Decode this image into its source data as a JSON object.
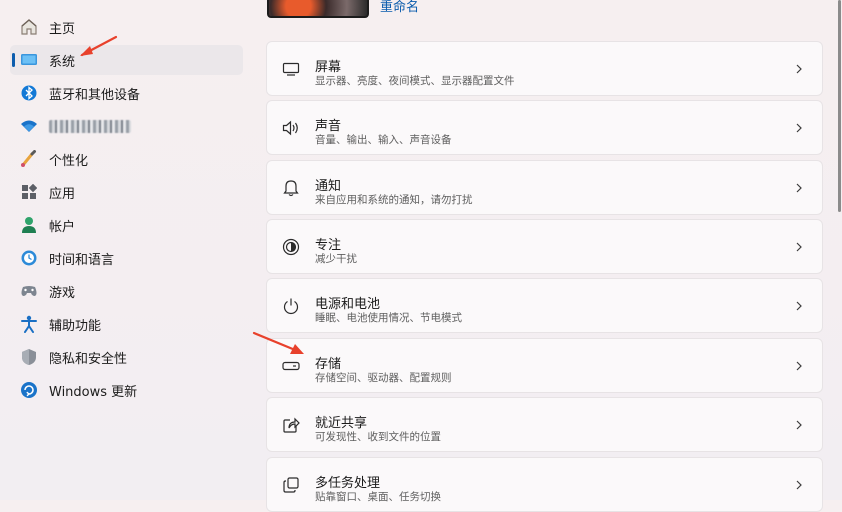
{
  "sidebar": {
    "items": [
      {
        "label": "主页",
        "icon": "home-icon"
      },
      {
        "label": "系统",
        "icon": "system-icon",
        "selected": true
      },
      {
        "label": "蓝牙和其他设备",
        "icon": "bluetooth-icon"
      },
      {
        "label": "",
        "icon": "wifi-icon"
      },
      {
        "label": "个性化",
        "icon": "personalization-icon"
      },
      {
        "label": "应用",
        "icon": "apps-icon"
      },
      {
        "label": "帐户",
        "icon": "account-icon"
      },
      {
        "label": "时间和语言",
        "icon": "time-language-icon"
      },
      {
        "label": "游戏",
        "icon": "gaming-icon"
      },
      {
        "label": "辅助功能",
        "icon": "accessibility-icon"
      },
      {
        "label": "隐私和安全性",
        "icon": "privacy-shield-icon"
      },
      {
        "label": "Windows 更新",
        "icon": "windows-update-icon"
      }
    ]
  },
  "device": {
    "rename_label": "重命名"
  },
  "settings": [
    {
      "title": "屏幕",
      "subtitle": "显示器、亮度、夜间模式、显示器配置文件",
      "icon": "display-icon"
    },
    {
      "title": "声音",
      "subtitle": "音量、输出、输入、声音设备",
      "icon": "sound-icon"
    },
    {
      "title": "通知",
      "subtitle": "来自应用和系统的通知，请勿打扰",
      "icon": "notification-bell-icon"
    },
    {
      "title": "专注",
      "subtitle": "减少干扰",
      "icon": "focus-icon"
    },
    {
      "title": "电源和电池",
      "subtitle": "睡眠、电池使用情况、节电模式",
      "icon": "power-icon"
    },
    {
      "title": "存储",
      "subtitle": "存储空间、驱动器、配置规则",
      "icon": "storage-drive-icon"
    },
    {
      "title": "就近共享",
      "subtitle": "可发现性、收到文件的位置",
      "icon": "nearby-share-icon"
    },
    {
      "title": "多任务处理",
      "subtitle": "贴靠窗口、桌面、任务切换",
      "icon": "multitasking-icon"
    }
  ],
  "colors": {
    "accent": "#0b5cad",
    "annotation_arrow": "#e8412c"
  }
}
